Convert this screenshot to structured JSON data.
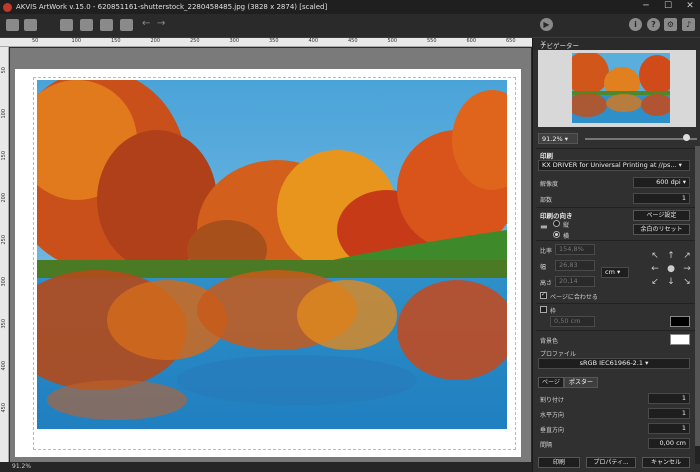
{
  "window": {
    "title": "AKVIS ArtWork v.15.0 - 620851161-shutterstock_2280458485.jpg (3828 x 2874) [scaled]"
  },
  "toolbar": {
    "left_icons": [
      "open-icon",
      "save-icon",
      "print-icon",
      "export-icon",
      "share-icon",
      "batch-icon"
    ],
    "right_icons": [
      "play-icon",
      "info-icon",
      "help-icon",
      "settings-icon",
      "bell-icon"
    ],
    "info_glyph": "i",
    "help_glyph": "?"
  },
  "ruler": {
    "top_ticks": [
      "50",
      "100",
      "150",
      "200",
      "250",
      "300",
      "350",
      "400",
      "450",
      "500",
      "550",
      "600",
      "650"
    ],
    "left_ticks": [
      "50",
      "100",
      "150",
      "200",
      "250",
      "300",
      "350",
      "400",
      "450"
    ]
  },
  "status": {
    "zoom": "91.2%"
  },
  "navigator": {
    "title": "ナビゲーター",
    "zoom": "91.2%",
    "zoom_fraction": 0.93
  },
  "print": {
    "section_title": "印刷",
    "printer": "KX DRIVER for Universal Printing at //ps...",
    "resolution_label": "解像度",
    "resolution": "600 dpi",
    "copies_label": "部数",
    "copies": "1",
    "orientation_title": "印刷の向き",
    "portrait_label": "縦",
    "landscape_label": "横",
    "page_setup_button": "ページ設定",
    "reset_margins_button": "余白のリセット",
    "scale_label": "比率",
    "scale": "154,8%",
    "width_label": "幅",
    "width": "26,83",
    "height_label": "高さ",
    "height": "20,14",
    "unit": "cm",
    "fit_page_label": "ページに合わせる",
    "frame_label": "枠",
    "frame_width": "0,50 cm",
    "frame_color": "#000000",
    "bg_label": "背景色",
    "bg_color": "#ffffff",
    "profile_label": "プロファイル",
    "profile": "sRGB IEC61966-2.1",
    "tabs": [
      "ページ",
      "ポスター"
    ],
    "split_label": "割り付け",
    "split": "1",
    "horizontal_label": "水平方向",
    "horizontal": "1",
    "vertical_label": "垂直方向",
    "vertical": "1",
    "spacing_label": "間隔",
    "spacing": "0,00 cm",
    "print_button": "印刷",
    "properties_button": "プロパティ...",
    "cancel_button": "キャンセル"
  }
}
